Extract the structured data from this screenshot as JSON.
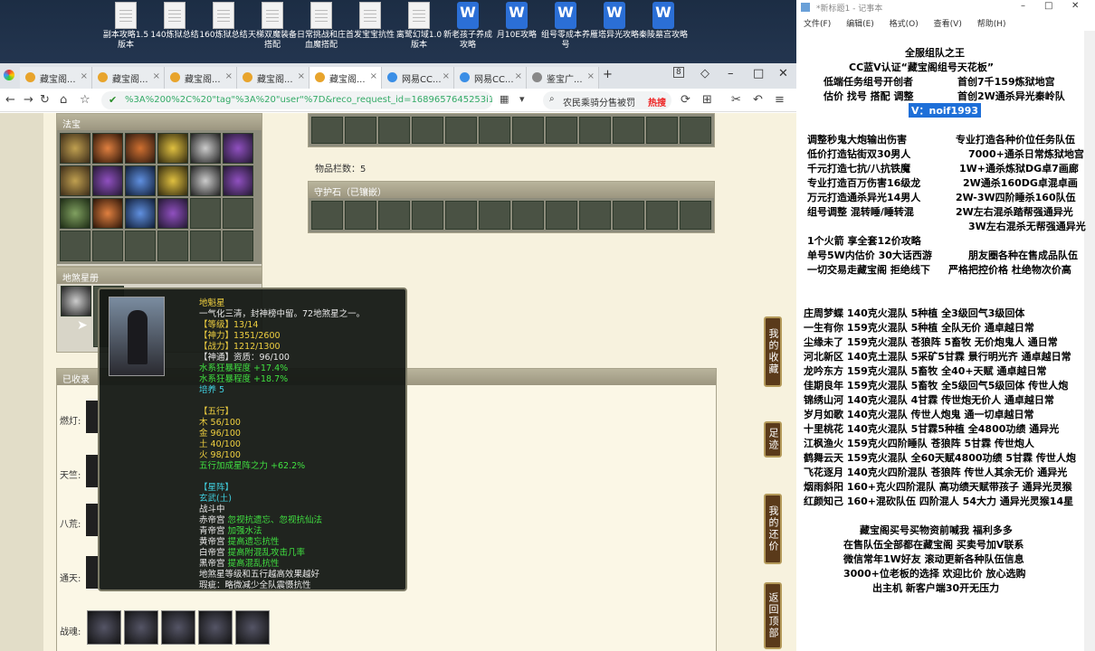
{
  "desktop": {
    "icons": [
      {
        "label": "副本攻略1.5版本",
        "type": "file"
      },
      {
        "label": "140炼狱总结",
        "type": "file"
      },
      {
        "label": "160炼狱总结",
        "type": "file"
      },
      {
        "label": "天梯双魔装备搭配",
        "type": "file"
      },
      {
        "label": "日常挑战和庄血魔搭配",
        "type": "file"
      },
      {
        "label": "首发宝宝抗性",
        "type": "file"
      },
      {
        "label": "离鹭幻域1.0版本",
        "type": "file"
      },
      {
        "label": "新老孩子养成攻略",
        "type": "word"
      },
      {
        "label": "月10E攻略",
        "type": "word"
      },
      {
        "label": "组号零成本养号",
        "type": "word"
      },
      {
        "label": "雁塔异光攻略",
        "type": "word"
      },
      {
        "label": "秦陵墓宫攻略",
        "type": "word"
      }
    ]
  },
  "browser": {
    "tabs": [
      {
        "label": "藏宝阁..."
      },
      {
        "label": "藏宝阁..."
      },
      {
        "label": "藏宝阁..."
      },
      {
        "label": "藏宝阁..."
      },
      {
        "label": "藏宝阁..."
      },
      {
        "label": "网易CC..."
      },
      {
        "label": "网易CC..."
      },
      {
        "label": "鉴宝广..."
      }
    ],
    "tab_count": "8",
    "url": "%3A%200%2C%20\"tag\"%3A%20\"user\"%7D&reco_request_id=1689657645253i1Efw",
    "search_text": "农民乘骑分售被罚",
    "search_hot": "热搜",
    "add_tab": "+"
  },
  "game": {
    "fabao_title": "法宝",
    "item_count_label": "物品栏数：5",
    "guardian_title": "守护石（已镶嵌）",
    "disha_title": "地煞星册",
    "collected_title": "已收录",
    "row_labels": [
      "燃灯:",
      "天竺:",
      "八荒:",
      "通天:"
    ],
    "zhanhun_label": "战魂:"
  },
  "tooltip": {
    "name": "地魁星",
    "desc": "一气化三清，封神榜中留。72地煞星之一。",
    "level": "【等级】13/14",
    "shenli": "【神力】1351/2600",
    "zhanli": "【战力】1212/1300",
    "zizhi": "【神通】资质：96/100",
    "water_strong": "水系狂暴程度 +17.4%",
    "water_strong2": "水系狂暴程度 +18.7%",
    "peiyang": "培养 5",
    "wuxing_title": "【五行】",
    "mu": "木 56/100",
    "jin": "金 96/100",
    "tu": "土 40/100",
    "huo": "火 98/100",
    "wuxing_bonus": "五行加成星阵之力 +62.2%",
    "xingzhen_title": "【星阵】",
    "xuanwu": "玄武(土)",
    "zhandou": "战斗中",
    "chidi": "赤帝宫",
    "chidi_eff": "忽视抗遗忘、忽视抗仙法",
    "qingdi": "青帝宫",
    "qingdi_eff": "加强水法",
    "huangdi": "黄帝宫",
    "huangdi_eff": "提高遗忘抗性",
    "baidi": "白帝宫",
    "baidi_eff": "提高附混乱攻击几率",
    "heidi": "黑帝宫",
    "heidi_eff": "提高混乱抗性",
    "note": "地煞星等级和五行越高效果越好",
    "flaw": "瑕疵：略微减少全队震慑抗性"
  },
  "sidenav": [
    "我的收藏",
    "足迹",
    "我的还价",
    "返回顶部"
  ],
  "notepad": {
    "title": "*新标题1 - 记事本",
    "menu": [
      "文件(F)",
      "编辑(E)",
      "格式(O)",
      "查看(V)",
      "帮助(H)"
    ],
    "lines": [
      "全服组队之王",
      "CC蓝V认证“藏宝阁组号天花板”",
      "低端任务组号开创者",
      "首创7千159炼狱地宫",
      "估价 找号 搭配 调整",
      "首创2W通杀异光秦岭队",
      "V：noif1993",
      "调整秒鬼大炮输出伤害",
      "专业打造各种价位任务队伍",
      "低价打造钻街双30男人",
      "7000+通杀日常炼狱地宫",
      "千元打造七抗/八抗铁魔",
      "1W+通杀炼狱DG卓7画廊",
      "专业打造百万伤害16级龙",
      "2W通杀160DG卓混卓画",
      "万元打造通杀异光14男人",
      "2W-3W四阶睡杀160队伍",
      "组号调整 混转睡/睡转混",
      "2W左右混杀踏帮强通异光",
      "3W左右混杀无帮强通异光",
      "1个火箭 享全套12价攻略",
      "单号5W内估价 30大话西游",
      "朋友圈各种在售成品队伍",
      "一切交易走藏宝阁 拒绝线下",
      "严格把控价格 杜绝物次价高",
      "庄周梦蝶 140克火混队 5种植 全3级回气3级回体",
      "一生有你 159克火混队 5种植 全队无价 通卓越日常",
      "尘缘未了 159克火混队 苍狼阵 5畜牧 无价炮鬼人 通日常",
      "河北新区 140克土混队 5采矿5甘霖 景行明光齐 通卓越日常",
      "龙吟东方 159克火混队 5畜牧 全40+天赋 通卓越日常",
      "佳期良年 159克火混队 5畜牧 全5级回气5级回体 传世人炮",
      "锦绣山河 140克火混队 4甘霖 传世炮无价人 通卓越日常",
      "岁月如歌 140克火混队 传世人炮鬼 通一切卓越日常",
      "十里桃花 140克火混队 5甘霖5种植 全4800功绩 通异光",
      "江枫渔火 159克火四阶睡队 苍狼阵 5甘霖 传世炮人",
      "鹤舞云天 159克火混队 全60天赋4800功绩 5甘霖 传世人炮",
      "飞花逐月 140克火四阶混队 苍狼阵 传世人其余无价 通异光",
      "烟雨斜阳 160+克火四阶混队 高功绩天赋带孩子 通异光灵猴",
      "红颜知己 160+混砍队伍 四阶混人 54大力 通异光灵猴14星",
      "藏宝阁买号买物资前喊我 福利多多",
      "在售队伍全部都在藏宝阁 买卖号加V联系",
      "微信常年1W好友 滚动更新各种队伍信息",
      "3000+位老板的选择 欢迎比价 放心选购",
      "出主机 新客户端30开无压力"
    ]
  }
}
